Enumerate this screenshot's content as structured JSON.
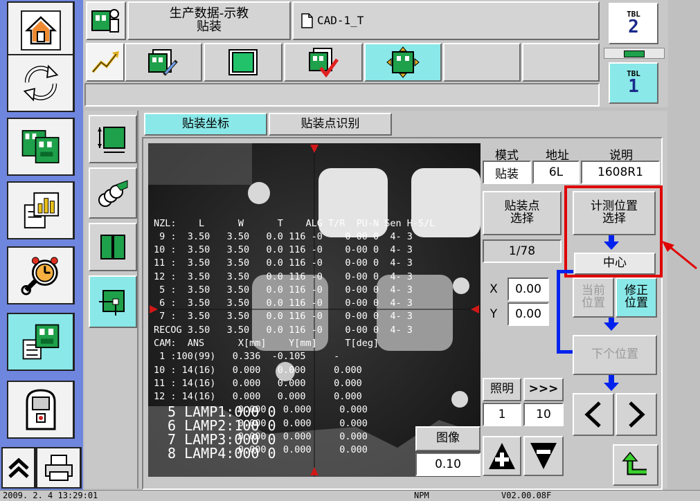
{
  "header": {
    "title_line1": "生产数据-示教",
    "title_line2": "贴装",
    "file_name": "CAD-1_T"
  },
  "tbl": {
    "top_label": "TBL",
    "top_value": "2",
    "bottom_label": "TBL",
    "bottom_value": "1"
  },
  "tabs": [
    "贴装坐标",
    "贴装点识别"
  ],
  "info": {
    "headers": [
      "模式",
      "地址",
      "说明"
    ],
    "values": [
      "贴装",
      "6L",
      "1608R1"
    ]
  },
  "buttons": {
    "mount_point_select": "贴装点\n选择",
    "measure_pos_select": "计测位置\n选择",
    "center": "中心",
    "current_pos": "当前\n位置",
    "correct_pos": "修正\n位置",
    "next_pos": "下个位置",
    "lighting": "照明",
    "skip": ">>>",
    "image": "图像"
  },
  "counter": "1/78",
  "coords": {
    "x_label": "X",
    "x_value": "0.00",
    "y_label": "Y",
    "y_value": "0.00"
  },
  "lighting_values": [
    "1",
    "10"
  ],
  "image_value": "0.10",
  "camera_overlay": {
    "nzl_header": "NZL:    L      W      T    ALG T/R  PU-N Sen H-S/L",
    "nzl_rows": [
      " 9 :  3.50   3.50   0.0 116 -0    0-00 0  4- 3",
      "10 :  3.50   3.50   0.0 116 -0    0-00 0  4- 3",
      "11 :  3.50   3.50   0.0 116 -0    0-00 0  4- 3",
      "12 :  3.50   3.50   0.0 116 -0    0-00 0  4- 3",
      " 5 :  3.50   3.50   0.0 116 -0    0-00 0  4- 3",
      " 6 :  3.50   3.50   0.0 116 -0    0-00 0  4- 3",
      " 7 :  3.50   3.50   0.0 116 -0    0-00 0  4- 3",
      "RECOG 3.50   3.50   0.0 116 -0    0-00 0  4- 3"
    ],
    "cam_header": "CAM:  ANS      X[mm]    Y[mm]     T[deg]",
    "cam_rows": [
      " 1 :100(99)   0.336  -0.105     -",
      "10 : 14(16)   0.000   0.000     0.000",
      "11 : 14(16)   0.000   0.000     0.000",
      "12 : 14(16)   0.000   0.000     0.000",
      "               0.000   0.000     0.000",
      "               0.000   0.000     0.000",
      "               0.000   0.000     0.000",
      "               0.000   0.000     0.000"
    ],
    "lamp_rows": [
      "5 LAMP1:000 0",
      "6 LAMP2:100 0",
      "7 LAMP3:000 0",
      "8 LAMP4:000 0"
    ]
  },
  "status_bar": {
    "datetime": "2009.  2.  4 13:29:01",
    "machine": "NPM",
    "version": "V02.00.08F"
  },
  "colors": {
    "selected": "#8ae8e8",
    "highlight": "#e00000",
    "flow_arrow": "#0022ee",
    "sidebar_bg": "#6f86de"
  }
}
